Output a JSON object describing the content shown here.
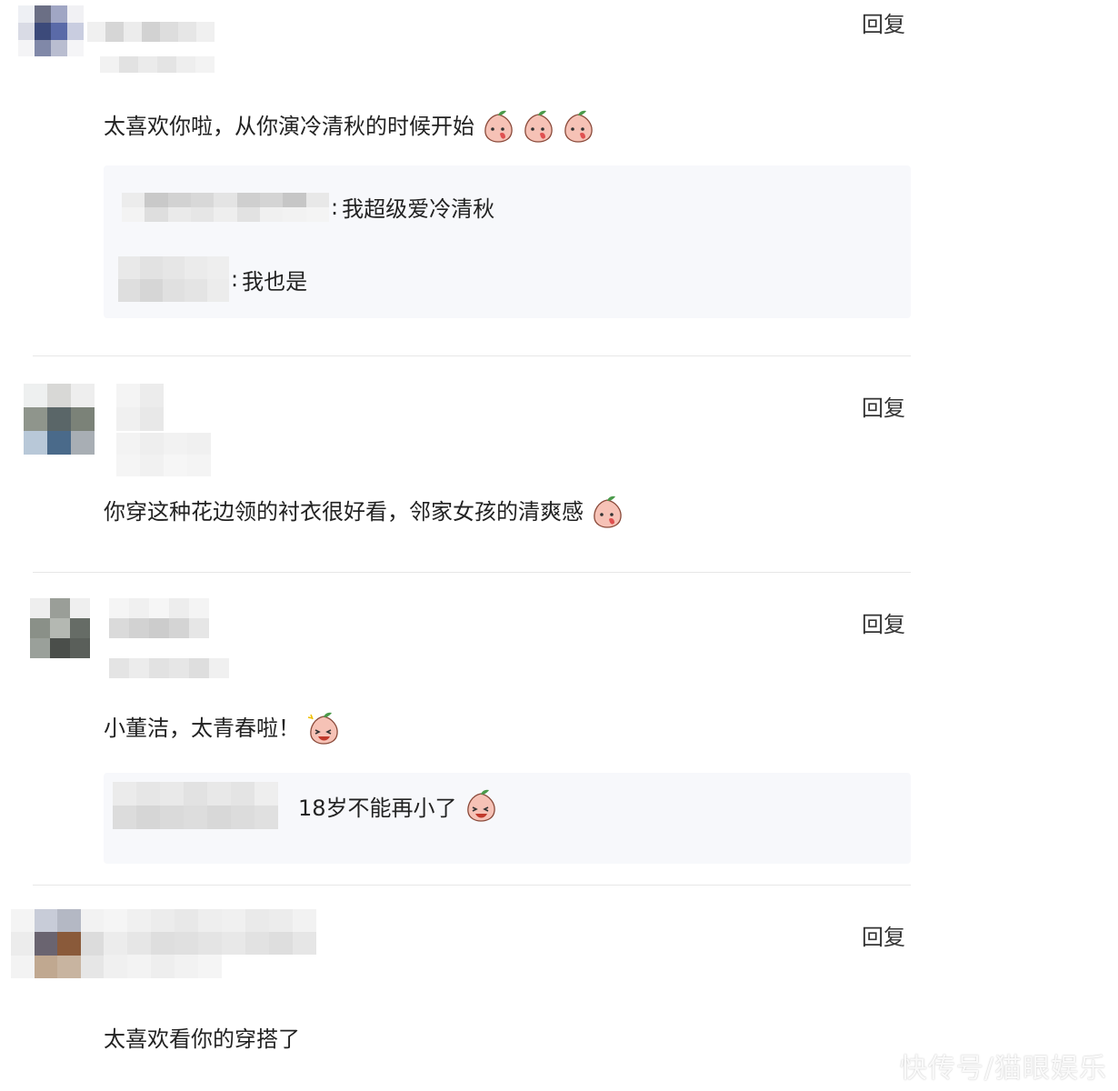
{
  "comments": [
    {
      "reply_label": "回复",
      "text": "太喜欢你啦，从你演冷清秋的时候开始",
      "emoji": [
        "peach-emoji",
        "peach-emoji",
        "peach-emoji"
      ],
      "subreplies": [
        {
          "text": "我超级爱冷清秋"
        },
        {
          "text": "我也是"
        }
      ]
    },
    {
      "reply_label": "回复",
      "text": "你穿这种花边领的衬衣很好看，邻家女孩的清爽感",
      "emoji": [
        "peach-emoji"
      ]
    },
    {
      "reply_label": "回复",
      "text": "小董洁，太青春啦！",
      "emoji": [
        "peach-laugh-emoji"
      ],
      "subreplies": [
        {
          "text": "18岁不能再小了"
        }
      ]
    },
    {
      "reply_label": "回复",
      "text": "太喜欢看你的穿搭了"
    }
  ],
  "watermark": "快传号/猫眼娱乐",
  "colors": {
    "text": "#222222",
    "divider": "#e7e7e7",
    "subreply_bg": "#f7f8fb"
  }
}
